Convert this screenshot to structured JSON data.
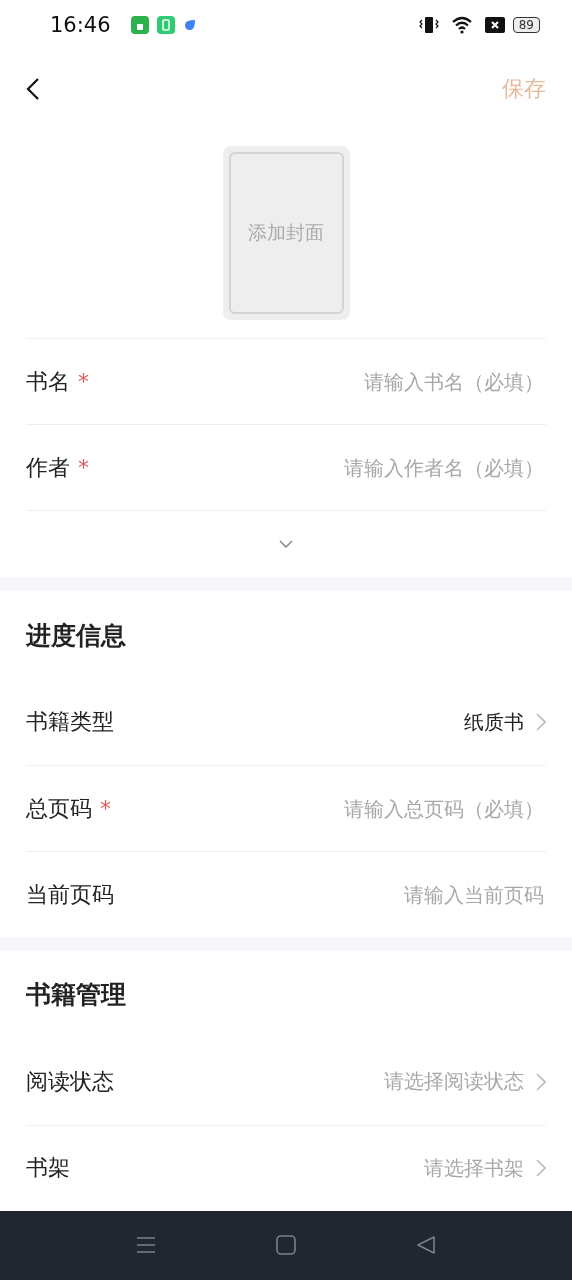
{
  "status_bar": {
    "time": "16:46",
    "battery": "89"
  },
  "header": {
    "save": "保存"
  },
  "cover": {
    "label": "添加封面"
  },
  "basic_fields": [
    {
      "kind": "input",
      "label": "书名",
      "required_mark": "*",
      "placeholder": "请输入书名（必填）"
    },
    {
      "kind": "input",
      "label": "作者",
      "required_mark": "*",
      "placeholder": "请输入作者名（必填）"
    }
  ],
  "sections": [
    {
      "title": "进度信息",
      "fields": [
        {
          "kind": "select",
          "label": "书籍类型",
          "value": "纸质书"
        },
        {
          "kind": "input",
          "label": "总页码",
          "required_mark": "*",
          "placeholder": "请输入总页码（必填）"
        },
        {
          "kind": "input",
          "label": "当前页码",
          "placeholder": "请输入当前页码"
        }
      ]
    },
    {
      "title": "书籍管理",
      "fields": [
        {
          "kind": "select",
          "label": "阅读状态",
          "placeholder": "请选择阅读状态"
        },
        {
          "kind": "select",
          "label": "书架",
          "placeholder": "请选择书架"
        }
      ]
    }
  ]
}
